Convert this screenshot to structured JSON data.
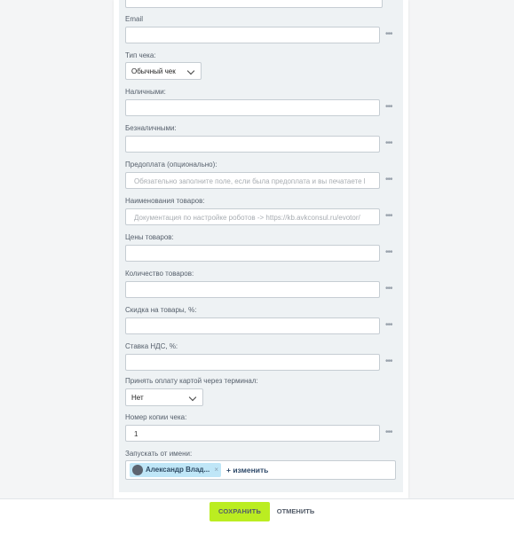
{
  "fields": [
    {
      "label": "Email",
      "value": ""
    },
    {
      "label": "Тип чека:",
      "selected": "Обычный чек"
    },
    {
      "label": "Наличными:",
      "value": ""
    },
    {
      "label": "Безналичными:",
      "value": ""
    },
    {
      "label": "Предоплата (опционально):",
      "placeholder": "Обязательно заполните поле, если была предоплата и вы печатаете l"
    },
    {
      "label": "Наименования товаров:",
      "placeholder": "Документация по настройке роботов -> https://kb.avkconsul.ru/evotor/"
    },
    {
      "label": "Цены товаров:",
      "value": ""
    },
    {
      "label": "Количество товаров:",
      "value": ""
    },
    {
      "label": "Скидка на товары, %:",
      "value": ""
    },
    {
      "label": "Ставка НДС, %:",
      "value": ""
    },
    {
      "label": "Принять оплату картой через терминал:",
      "selected": "Нет"
    },
    {
      "label": "Номер копии чека:",
      "value": "1"
    },
    {
      "label": "Запускать от имени:",
      "user": "Александр Влад...",
      "remove": "×",
      "change": "+ изменить"
    }
  ],
  "more_icon": "•••",
  "footer": {
    "save": "СОХРАНИТЬ",
    "cancel": "ОТМЕНИТЬ"
  },
  "colors": {
    "save_bg": "#bbed21",
    "chip_bg": "#bfe6f7",
    "form_bg": "#eef2f4"
  }
}
